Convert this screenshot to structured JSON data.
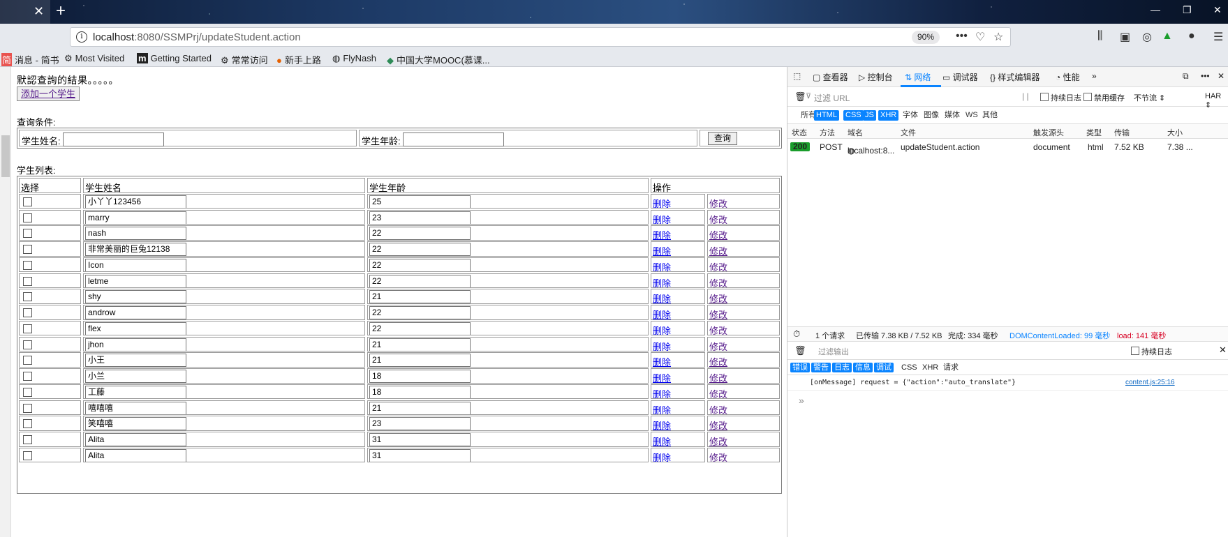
{
  "browser": {
    "url_host": "localhost",
    "url_rest": ":8080/SSMPrj/updateStudent.action",
    "zoom": "90%"
  },
  "bookmarks": [
    {
      "icon": "简",
      "label": "消息 - 简书"
    },
    {
      "icon": "⚙",
      "label": "Most Visited"
    },
    {
      "icon": "m",
      "label": "Getting Started"
    },
    {
      "icon": "⚙",
      "label": "常常访问"
    },
    {
      "icon": "●",
      "label": "新手上路"
    },
    {
      "icon": "◍",
      "label": "FlyNash"
    },
    {
      "icon": "◆",
      "label": "中国大学MOOC(慕课..."
    }
  ],
  "page": {
    "result_title": "默認查詢的結果。。。。。",
    "add_button": "添加一个学生",
    "query_label": "查询条件:",
    "query_name_label": "学生姓名:",
    "query_age_label": "学生年龄:",
    "query_button": "查询",
    "list_label": "学生列表:",
    "columns": [
      "选择",
      "学生姓名",
      "学生年龄",
      "操作"
    ],
    "delete_label": "删除",
    "edit_label": "修改",
    "students": [
      {
        "name": "小丫丫123456",
        "age": "25"
      },
      {
        "name": "marry",
        "age": "23"
      },
      {
        "name": "nash",
        "age": "22"
      },
      {
        "name": "非常美丽的巨兔12138",
        "age": "22"
      },
      {
        "name": "Icon",
        "age": "22"
      },
      {
        "name": "letme",
        "age": "22"
      },
      {
        "name": "shy",
        "age": "21"
      },
      {
        "name": "androw",
        "age": "22"
      },
      {
        "name": "flex",
        "age": "22"
      },
      {
        "name": "jhon",
        "age": "21"
      },
      {
        "name": "小王",
        "age": "21"
      },
      {
        "name": "小兰",
        "age": "18"
      },
      {
        "name": "工藤",
        "age": "18"
      },
      {
        "name": "嘻嘻嘻",
        "age": "21"
      },
      {
        "name": "笑嘻嘻",
        "age": "23"
      },
      {
        "name": "Alita",
        "age": "31"
      },
      {
        "name": "Alita",
        "age": "31"
      }
    ]
  },
  "devtools": {
    "tabs": [
      "查看器",
      "控制台",
      "网络",
      "调试器",
      "样式编辑器",
      "性能"
    ],
    "active_tab": "网络",
    "filter_placeholder": "过滤 URL",
    "persist_log": "持续日志",
    "disable_cache": "禁用缓存",
    "throttle": "不节流 ⇕",
    "har": "HAR ⇕",
    "types": [
      "所有",
      "HTML",
      "CSS",
      "JS",
      "XHR",
      "字体",
      "图像",
      "媒体",
      "WS",
      "其他"
    ],
    "types_on": [
      "HTML",
      "CSS",
      "JS",
      "XHR"
    ],
    "columns": [
      "状态",
      "方法",
      "域名",
      "文件",
      "触发源头",
      "类型",
      "传输",
      "大小"
    ],
    "request": {
      "status": "200",
      "method": "POST",
      "domain": "localhost:8...",
      "file": "updateStudent.action",
      "cause": "document",
      "type": "html",
      "transferred": "7.52 KB",
      "size": "7.38 ..."
    },
    "summary": {
      "count": "1 个请求",
      "transferred": "已传输 7.38 KB / 7.52 KB",
      "finish": "完成: 334 毫秒",
      "dom": "DOMContentLoaded: 99 毫秒",
      "load": "load: 141 毫秒"
    },
    "console_filter": "过滤输出",
    "console_persist": "持续日志",
    "console_types": [
      "错误",
      "警告",
      "日志",
      "信息",
      "调试",
      "CSS",
      "XHR",
      "请求"
    ],
    "console_types_on": [
      "错误",
      "警告",
      "日志",
      "信息",
      "调试"
    ],
    "console_message": "[onMessage] request = {\"action\":\"auto_translate\"}",
    "console_source": "content.js:25:16",
    "colors": {
      "accent": "#0a84ff",
      "dom": "#0a84ff",
      "load": "#d70022",
      "status_ok": "#1a9d2c"
    }
  }
}
